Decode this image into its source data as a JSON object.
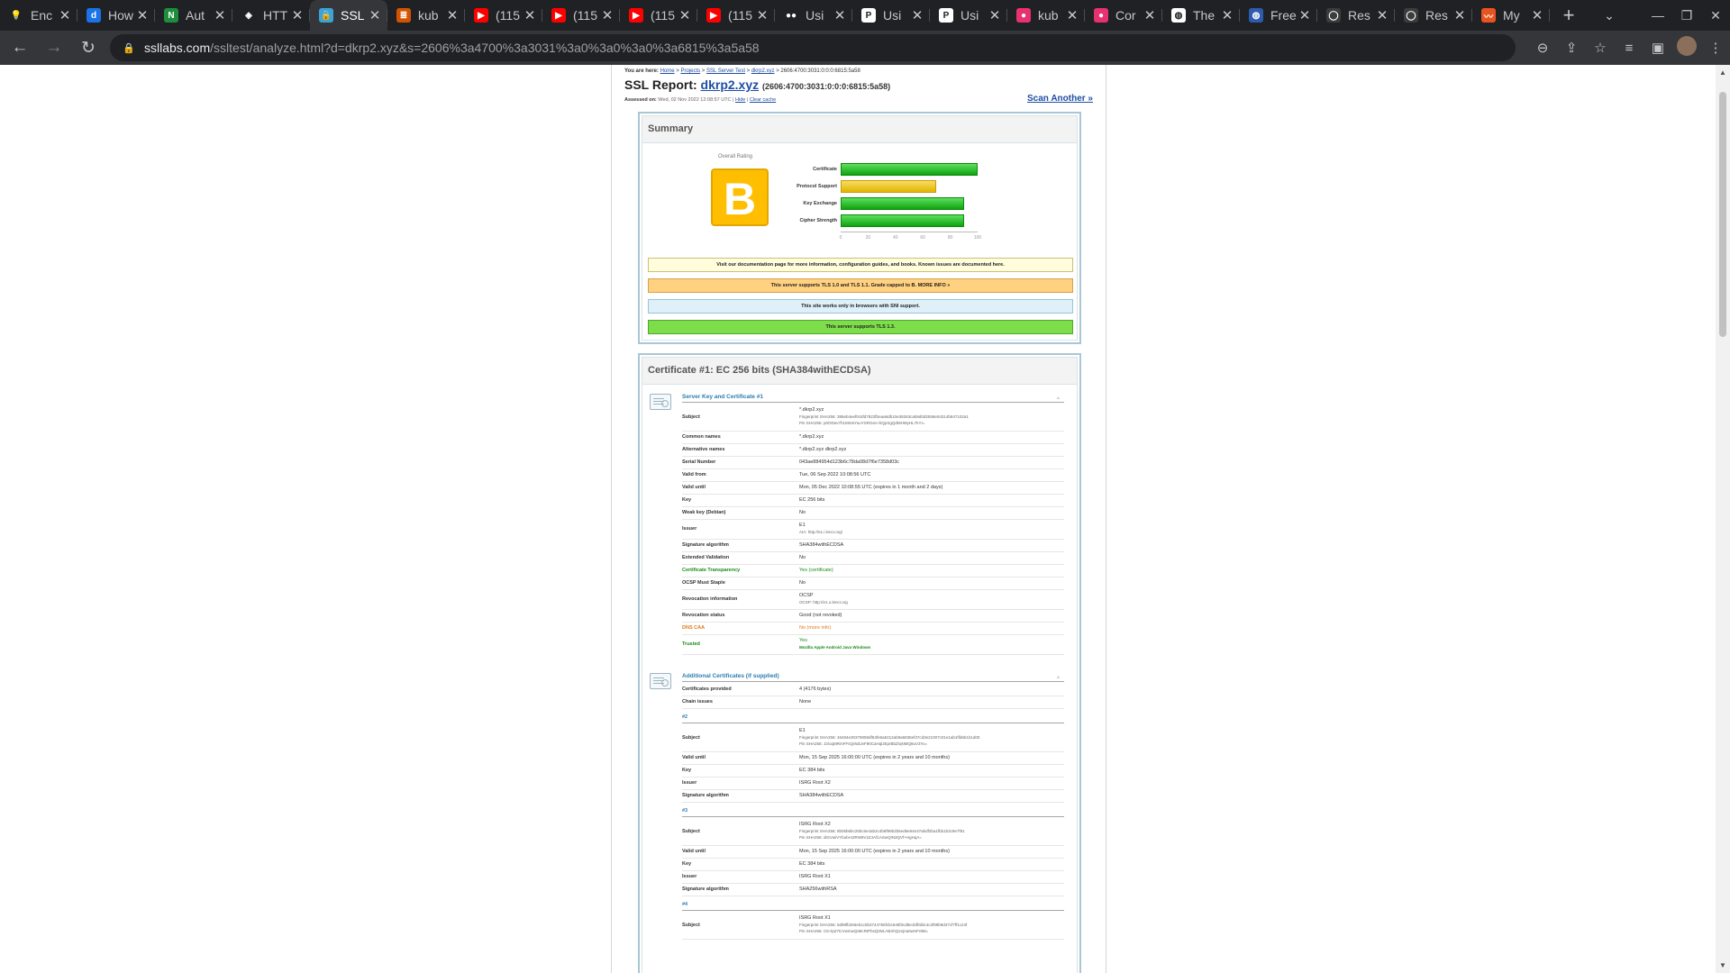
{
  "browser": {
    "tabs": [
      {
        "title": "Enc",
        "favicon_color": "#202124",
        "favicon": "bulb-icon"
      },
      {
        "title": "How",
        "favicon_color": "#1a73e8",
        "favicon": "d-icon"
      },
      {
        "title": "Aut",
        "favicon_color": "#1e8e3e",
        "favicon": "n-icon"
      },
      {
        "title": "HTT",
        "favicon_color": "#202124",
        "favicon": "gem-icon"
      },
      {
        "title": "SSL",
        "favicon_color": "#3aa3d8",
        "favicon": "lock-icon",
        "active": true
      },
      {
        "title": "kub",
        "favicon_color": "#d35400",
        "favicon": "stack-icon"
      },
      {
        "title": "(115",
        "favicon_color": "#ff0000",
        "favicon": "youtube-icon"
      },
      {
        "title": "(115",
        "favicon_color": "#ff0000",
        "favicon": "youtube-icon"
      },
      {
        "title": "(115",
        "favicon_color": "#ff0000",
        "favicon": "youtube-icon"
      },
      {
        "title": "(115",
        "favicon_color": "#ff0000",
        "favicon": "youtube-icon"
      },
      {
        "title": "Usi",
        "favicon_color": "#202124",
        "favicon": "medium-icon"
      },
      {
        "title": "Usi",
        "favicon_color": "#ffffff",
        "favicon": "p-icon"
      },
      {
        "title": "Usi",
        "favicon_color": "#ffffff",
        "favicon": "p-icon"
      },
      {
        "title": "kub",
        "favicon_color": "#e8316f",
        "favicon": "circle-icon"
      },
      {
        "title": "Cor",
        "favicon_color": "#e8316f",
        "favicon": "circle-icon"
      },
      {
        "title": "The",
        "favicon_color": "#ffffff",
        "favicon": "globe-icon"
      },
      {
        "title": "Free",
        "favicon_color": "#2c5bb0",
        "favicon": "globe-icon"
      },
      {
        "title": "Res",
        "favicon_color": "#3c3c3c",
        "favicon": "github-icon"
      },
      {
        "title": "Res",
        "favicon_color": "#3c3c3c",
        "favicon": "github-icon"
      },
      {
        "title": "My",
        "favicon_color": "#e8531f",
        "favicon": "chart-icon"
      }
    ],
    "url_host": "ssllabs.com",
    "url_path": "/ssltest/analyze.html?d=dkrp2.xyz&s=2606%3a4700%3a3031%3a0%3a0%3a0%3a6815%3a5a58"
  },
  "page": {
    "breadcrumb": {
      "prefix": "You are here:",
      "items": [
        "Home",
        "Projects",
        "SSL Server Test",
        "dkrp2.xyz"
      ],
      "current": "2606:4700:3031:0:0:0:6815:5a58"
    },
    "title_prefix": "SSL Report:",
    "domain": "dkrp2.xyz",
    "ip": "(2606:4700:3031:0:0:0:6815:5a58)",
    "assessed_label": "Assessed on:",
    "assessed_on": "Wed, 02 Nov 2022 12:08:57 UTC",
    "hide_link": "Hide",
    "clear_cache_link": "Clear cache",
    "scan_another": "Scan Another »"
  },
  "summary": {
    "title": "Summary",
    "overall_label": "Overall Rating",
    "grade": "B",
    "grade_color": "#ffbf00",
    "axis_ticks": [
      "0",
      "20",
      "40",
      "60",
      "80",
      "100"
    ],
    "notes": [
      {
        "text": "Visit our documentation page for more information, configuration guides, and books. Known issues are documented here.",
        "style": "yellow"
      },
      {
        "text": "This server supports TLS 1.0 and TLS 1.1. Grade capped to B. MORE INFO »",
        "style": "orange"
      },
      {
        "text": "This site works only in browsers with SNI support.",
        "style": "blue"
      },
      {
        "text": "This server supports TLS 1.3.",
        "style": "green"
      }
    ]
  },
  "chart_data": {
    "type": "bar",
    "orientation": "horizontal",
    "categories": [
      "Certificate",
      "Protocol Support",
      "Key Exchange",
      "Cipher Strength"
    ],
    "values": [
      100,
      70,
      90,
      90
    ],
    "colors": [
      "green",
      "yellow",
      "green",
      "green"
    ],
    "xlim": [
      0,
      100
    ],
    "xticks": [
      0,
      20,
      40,
      60,
      80,
      100
    ]
  },
  "certificate": {
    "title": "Certificate #1: EC 256 bits (SHA384withECDSA)",
    "server_key_title": "Server Key and Certificate #1",
    "rows": [
      {
        "k": "Subject",
        "v": "*.dkrp2.xyz",
        "sub": [
          "Fingerprint SHA256: 385eb4eef0c5fd7822fbeaa6db10e38263cab9d0d2558e04314b847102a1",
          "Pin SHA256: p0ODev7h1Mm6YuuYSRGev+bQpXgQdMHMyHL7kYI="
        ]
      },
      {
        "k": "Common names",
        "v": "*.dkrp2.xyz"
      },
      {
        "k": "Alternative names",
        "v": "*.dkrp2.xyz dkrp2.xyz"
      },
      {
        "k": "Serial Number",
        "v": "043ae884954d123b6c78da08d7f6e7358d03c"
      },
      {
        "k": "Valid from",
        "v": "Tue, 06 Sep 2022 10:08:56 UTC"
      },
      {
        "k": "Valid until",
        "v": "Mon, 05 Dec 2022 10:08:55 UTC (expires in 1 month and 2 days)"
      },
      {
        "k": "Key",
        "v": "EC 256 bits"
      },
      {
        "k": "Weak key (Debian)",
        "v": "No"
      },
      {
        "k": "Issuer",
        "v": "E1",
        "sub": [
          "AIA: http://e1.i.lencr.org/"
        ]
      },
      {
        "k": "Signature algorithm",
        "v": "SHA384withECDSA"
      },
      {
        "k": "Extended Validation",
        "v": "No"
      },
      {
        "k": "Certificate Transparency",
        "v": "Yes (certificate)",
        "style": "green"
      },
      {
        "k": "OCSP Must Staple",
        "v": "No"
      },
      {
        "k": "Revocation information",
        "v": "OCSP",
        "sub": [
          "OCSP: http://e1.o.lencr.org"
        ]
      },
      {
        "k": "Revocation status",
        "v": "Good (not revoked)"
      },
      {
        "k": "DNS CAA",
        "v": "No (more info)",
        "style": "orange"
      },
      {
        "k": "Trusted",
        "v": "Yes",
        "sub": [
          "Mozilla Apple Android Java Windows"
        ],
        "style": "green"
      }
    ],
    "additional_title": "Additional Certificates (if supplied)",
    "additional_rows": [
      {
        "k": "Certificates provided",
        "v": "4 (4176 bytes)"
      },
      {
        "k": "Chain issues",
        "v": "None"
      }
    ],
    "chain": [
      {
        "num": "#2",
        "rows": [
          {
            "k": "Subject",
            "v": "E1",
            "sub": [
              "Fingerprint SHA256: 46494e30379059df63fe6a5212ab9a6836ef37cd3e21007c01e1ab1ffd6b1b1d00",
              "Pin SHA256: J2/oqMRmFFsQr6dUvF90CaHqlJEprBbZ/qNMQ8uV3Yo="
            ]
          },
          {
            "k": "Valid until",
            "v": "Mon, 15 Sep 2025 16:00:00 UTC (expires in 2 years and 10 months)"
          },
          {
            "k": "Key",
            "v": "EC 384 bits"
          },
          {
            "k": "Issuer",
            "v": "ISRG Root X2"
          },
          {
            "k": "Signature algorithm",
            "v": "SHA384withECDSA"
          }
        ]
      },
      {
        "num": "#3",
        "rows": [
          {
            "k": "Subject",
            "v": "ISRG Root X2",
            "sub": [
              "Fingerprint SHA256: 8b05b6bc25bc6e4ab3c4b8f99b2b6ed6e64e37abdf2ba1fbb1b3c9e7f91",
              "Pin SHA256: diGVwiVYbubAI3RW8V2ZJAf1ASwQIN3QVf+HgHqA="
            ]
          },
          {
            "k": "Valid until",
            "v": "Mon, 15 Sep 2025 16:00:00 UTC (expires in 2 years and 10 months)"
          },
          {
            "k": "Key",
            "v": "EC 384 bits"
          },
          {
            "k": "Issuer",
            "v": "ISRG Root X1"
          },
          {
            "k": "Signature algorithm",
            "v": "SHA256withRSA"
          }
        ]
      },
      {
        "num": "#4",
        "rows": [
          {
            "k": "Subject",
            "v": "ISRG Root X1",
            "sub": [
              "Fingerprint SHA256: 6d99fb265eb1c5b3744765fcbc648f3cd8e1bffafdc4c2f99b9d47cf7ff1c24f",
              "Pin SHA256: C5+lpZ7tcVwmwQIMcRtPbsQtWLABXhQzejna0wHFr8M="
            ]
          }
        ]
      }
    ]
  }
}
